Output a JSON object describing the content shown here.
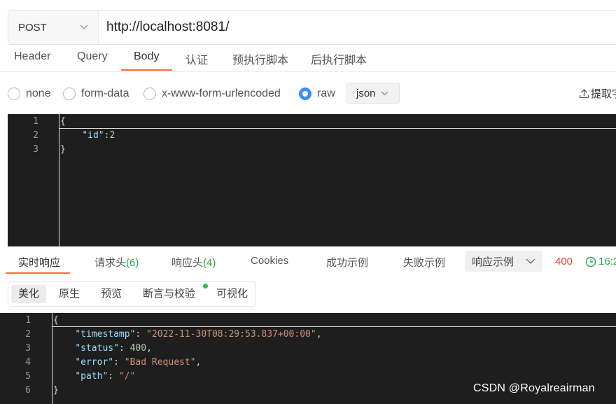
{
  "request": {
    "method": "POST",
    "url": "http://localhost:8081/"
  },
  "request_tabs": [
    "Header",
    "Query",
    "Body",
    "认证",
    "预执行脚本",
    "后执行脚本"
  ],
  "active_request_tab": "Body",
  "body_types": [
    {
      "label": "none",
      "checked": false
    },
    {
      "label": "form-data",
      "checked": false
    },
    {
      "label": "x-www-form-urlencoded",
      "checked": false
    },
    {
      "label": "raw",
      "checked": true
    }
  ],
  "raw_format": "json",
  "extract_label": "提取字",
  "request_body": {
    "line_numbers": [
      "1",
      "2",
      "3"
    ],
    "lines": [
      "{",
      "    \"id\":2",
      "}"
    ]
  },
  "response_tabs": {
    "realtime": "实时响应",
    "req_headers": "请求头",
    "req_headers_count": "(6)",
    "resp_headers": "响应头",
    "resp_headers_count": "(4)",
    "cookies": "Cookies",
    "success_example": "成功示例",
    "fail_example": "失败示例"
  },
  "example_select": "响应示例",
  "status_code": "400",
  "response_time": "16:2",
  "view_tabs": [
    "美化",
    "原生",
    "预览",
    "断言与校验",
    "可视化"
  ],
  "active_view_tab": "美化",
  "response_body": {
    "line_numbers": [
      "1",
      "2",
      "3",
      "4",
      "5",
      "6"
    ],
    "timestamp_key": "\"timestamp\"",
    "timestamp_val": "\"2022-11-30T08:29:53.837+00:00\"",
    "status_key": "\"status\"",
    "status_val": "400",
    "error_key": "\"error\"",
    "error_val": "\"Bad Request\"",
    "path_key": "\"path\"",
    "path_val": "\"/\""
  },
  "watermark": "CSDN @Royalreairman",
  "colors": {
    "accent": "#ff6a3d",
    "radio_checked": "#3b8ff6",
    "status_error": "#e8413b",
    "success": "#28a745",
    "editor_bg": "#1e1e1e"
  }
}
